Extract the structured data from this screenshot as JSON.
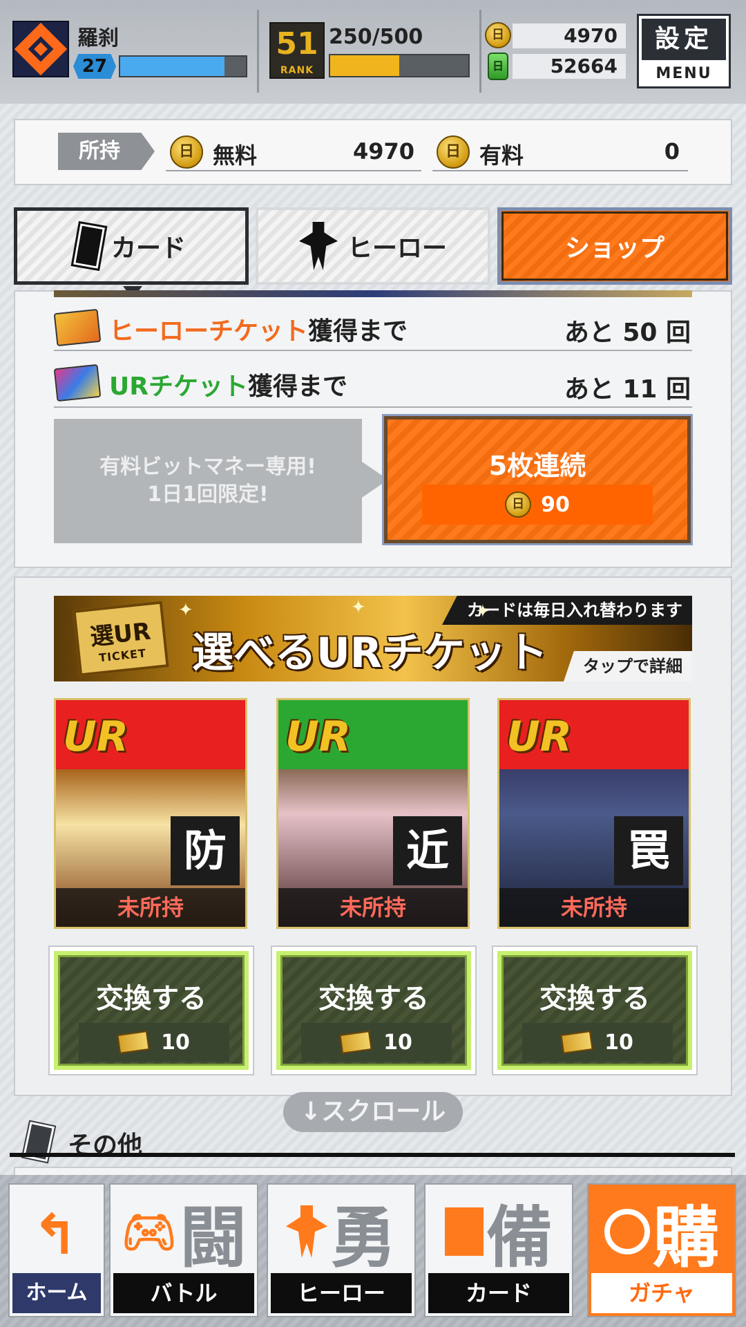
{
  "header": {
    "player_name": "羅刹",
    "level": "27",
    "hp_fraction": 0.83,
    "rank": "51",
    "rank_label": "RANK",
    "xp_text": "250/500",
    "xp_fraction": 0.5,
    "coins": "4970",
    "gems": "52664",
    "coin_symbol": "日",
    "menu_top": "設定",
    "menu_bottom": "MENU"
  },
  "balance": {
    "owned_label": "所持",
    "free_label": "無料",
    "free_value": "4970",
    "paid_label": "有料",
    "paid_value": "0"
  },
  "tabs": [
    {
      "label": "カード",
      "active": true
    },
    {
      "label": "ヒーロー",
      "active": false
    },
    {
      "label": "ショップ",
      "active": false
    }
  ],
  "gacha_progress": {
    "hero_ticket_name": "ヒーローチケット",
    "hero_ticket_suffix": "獲得まで",
    "hero_ticket_remaining": "あと 50 回",
    "ur_ticket_name": "URチケット",
    "ur_ticket_suffix": "獲得まで",
    "ur_ticket_remaining": "あと 11 回"
  },
  "limited_offer": {
    "line1": "有料ビットマネー専用!",
    "line2": "1日1回限定!",
    "button_title": "5枚連続",
    "button_price": "90"
  },
  "ur_banner": {
    "badge_top": "選UR",
    "badge_bottom": "TICKET",
    "headline": "選べるURチケット",
    "notice": "カードは毎日入れ替わります",
    "details": "タップで詳細"
  },
  "cards": [
    {
      "rarity": "UR",
      "type": "防",
      "status": "未所持",
      "color": "#e82020"
    },
    {
      "rarity": "UR",
      "type": "近",
      "status": "未所持",
      "color": "#2aa832"
    },
    {
      "rarity": "UR",
      "type": "罠",
      "status": "未所持",
      "color": "#e82020"
    }
  ],
  "exchange": [
    {
      "label": "交換する",
      "cost": "10"
    },
    {
      "label": "交換する",
      "cost": "10"
    },
    {
      "label": "交換する",
      "cost": "10"
    }
  ],
  "scroll_hint": "↓スクロール",
  "other_section": "その他",
  "bottom_nav": [
    {
      "label": "ホーム",
      "kanji": ""
    },
    {
      "label": "バトル",
      "kanji": "闘"
    },
    {
      "label": "ヒーロー",
      "kanji": "勇"
    },
    {
      "label": "カード",
      "kanji": "備"
    },
    {
      "label": "ガチャ",
      "kanji": "購",
      "active": true
    }
  ]
}
